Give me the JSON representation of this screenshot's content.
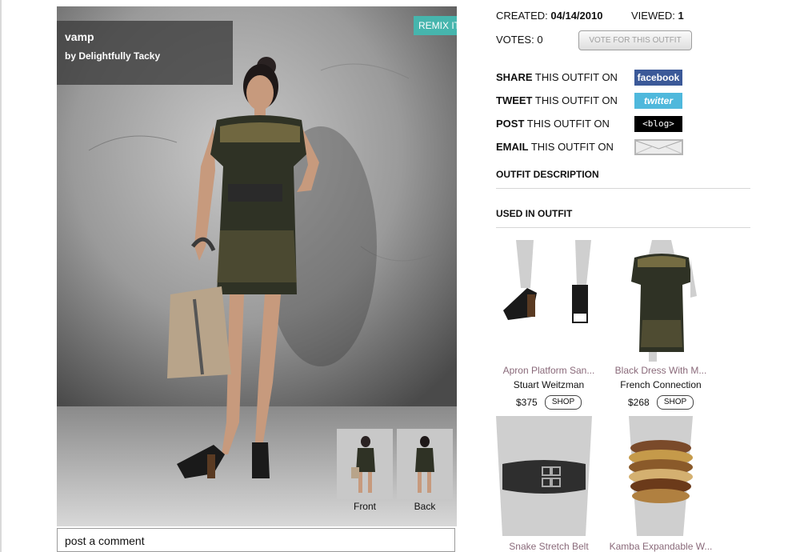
{
  "outfit": {
    "title": "vamp",
    "author": "by Delightfully Tacky",
    "remix_label": "REMIX IT",
    "views": [
      {
        "label": "Front"
      },
      {
        "label": "Back"
      }
    ]
  },
  "comment": {
    "placeholder": "post a comment"
  },
  "meta": {
    "created_label": "CREATED:",
    "created_value": "04/14/2010",
    "viewed_label": "VIEWED:",
    "viewed_value": "1",
    "votes_label": "VOTES:",
    "votes_value": "0",
    "vote_button": "VOTE FOR THIS OUTFIT"
  },
  "share": [
    {
      "verb": "SHARE",
      "rest": "THIS OUTFIT ON",
      "button": "facebook"
    },
    {
      "verb": "TWEET",
      "rest": "THIS OUTFIT ON",
      "button": "twitter"
    },
    {
      "verb": "POST",
      "rest": "THIS OUTFIT ON",
      "button": "<blog>"
    },
    {
      "verb": "EMAIL",
      "rest": "THIS OUTFIT ON",
      "button": ""
    }
  ],
  "sections": {
    "description": "OUTFIT DESCRIPTION",
    "used": "USED IN OUTFIT"
  },
  "products": [
    {
      "name": "Apron Platform San...",
      "brand": "Stuart Weitzman",
      "price": "$375",
      "shop": "SHOP"
    },
    {
      "name": "Black Dress With M...",
      "brand": "French Connection",
      "price": "$268",
      "shop": "SHOP"
    },
    {
      "name": "Snake Stretch Belt"
    },
    {
      "name": "Kamba Expandable W..."
    }
  ],
  "colors": {
    "remix": "#46b5ad",
    "facebook": "#3b5998",
    "twitter": "#4fb8dc",
    "product_name": "#8a6a7a"
  }
}
